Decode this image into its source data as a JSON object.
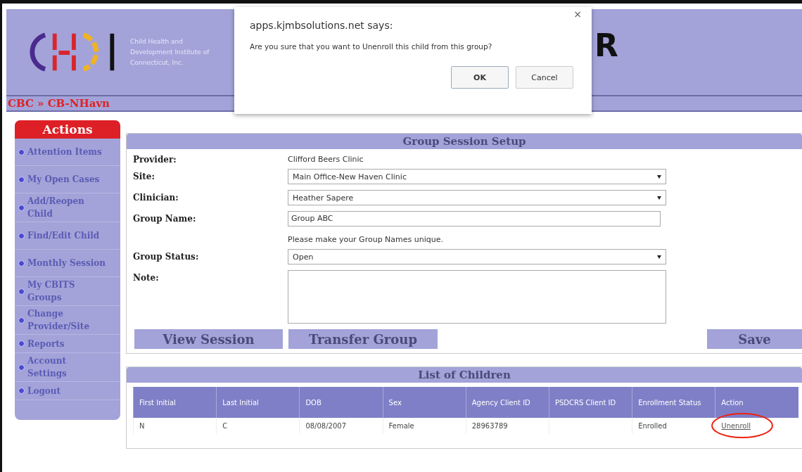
{
  "header": {
    "org_name": "Child Health and Development Institute of Connecticut, Inc.",
    "banner_fragment": "R",
    "breadcrumb": "CBC » CB-NHavn"
  },
  "dialog": {
    "title": "apps.kjmbsolutions.net says:",
    "message": "Are you sure that you want to Unenroll this child from this group?",
    "close": "×",
    "buttons": [
      "OK",
      "Cancel"
    ]
  },
  "sidebar": {
    "title": "Actions",
    "items": [
      {
        "label": "Attention Items"
      },
      {
        "label": "My Open Cases"
      },
      {
        "label": "Add/Reopen Child"
      },
      {
        "label": "Find/Edit Child"
      },
      {
        "label": "Monthly Session"
      },
      {
        "label": "My CBITS Groups"
      },
      {
        "label": "Change Provider/Site"
      },
      {
        "label": "Reports"
      },
      {
        "label": "Account Settings"
      },
      {
        "label": "Logout"
      }
    ]
  },
  "setup": {
    "title": "Group Session Setup",
    "fields": [
      {
        "kind": "text",
        "label": "Provider:",
        "value": "Clifford Beers Clinic"
      },
      {
        "kind": "select",
        "label": "Site:",
        "value": "Main Office-New Haven Clinic"
      },
      {
        "kind": "select",
        "label": "Clinician:",
        "value": "Heather Sapere"
      },
      {
        "kind": "input",
        "label": "Group Name:",
        "value": "Group ABC"
      },
      {
        "kind": "hint",
        "value": "Please make your Group Names unique."
      },
      {
        "kind": "select",
        "label": "Group Status:",
        "value": "Open"
      },
      {
        "kind": "textarea",
        "label": "Note:"
      }
    ],
    "buttons": [
      "View Session",
      "Transfer Group",
      "Save"
    ]
  },
  "children": {
    "title": "List of Children",
    "columns": [
      "First Initial",
      "Last Initial",
      "DOB",
      "Sex",
      "Agency Client ID",
      "PSDCRS Client ID",
      "Enrollment Status",
      "Action"
    ],
    "rows": [
      {
        "cells": [
          "N",
          "C",
          "08/08/2007",
          "Female",
          "28963789",
          "",
          "Enrolled"
        ],
        "action": "Unenroll",
        "circled": true
      }
    ]
  }
}
